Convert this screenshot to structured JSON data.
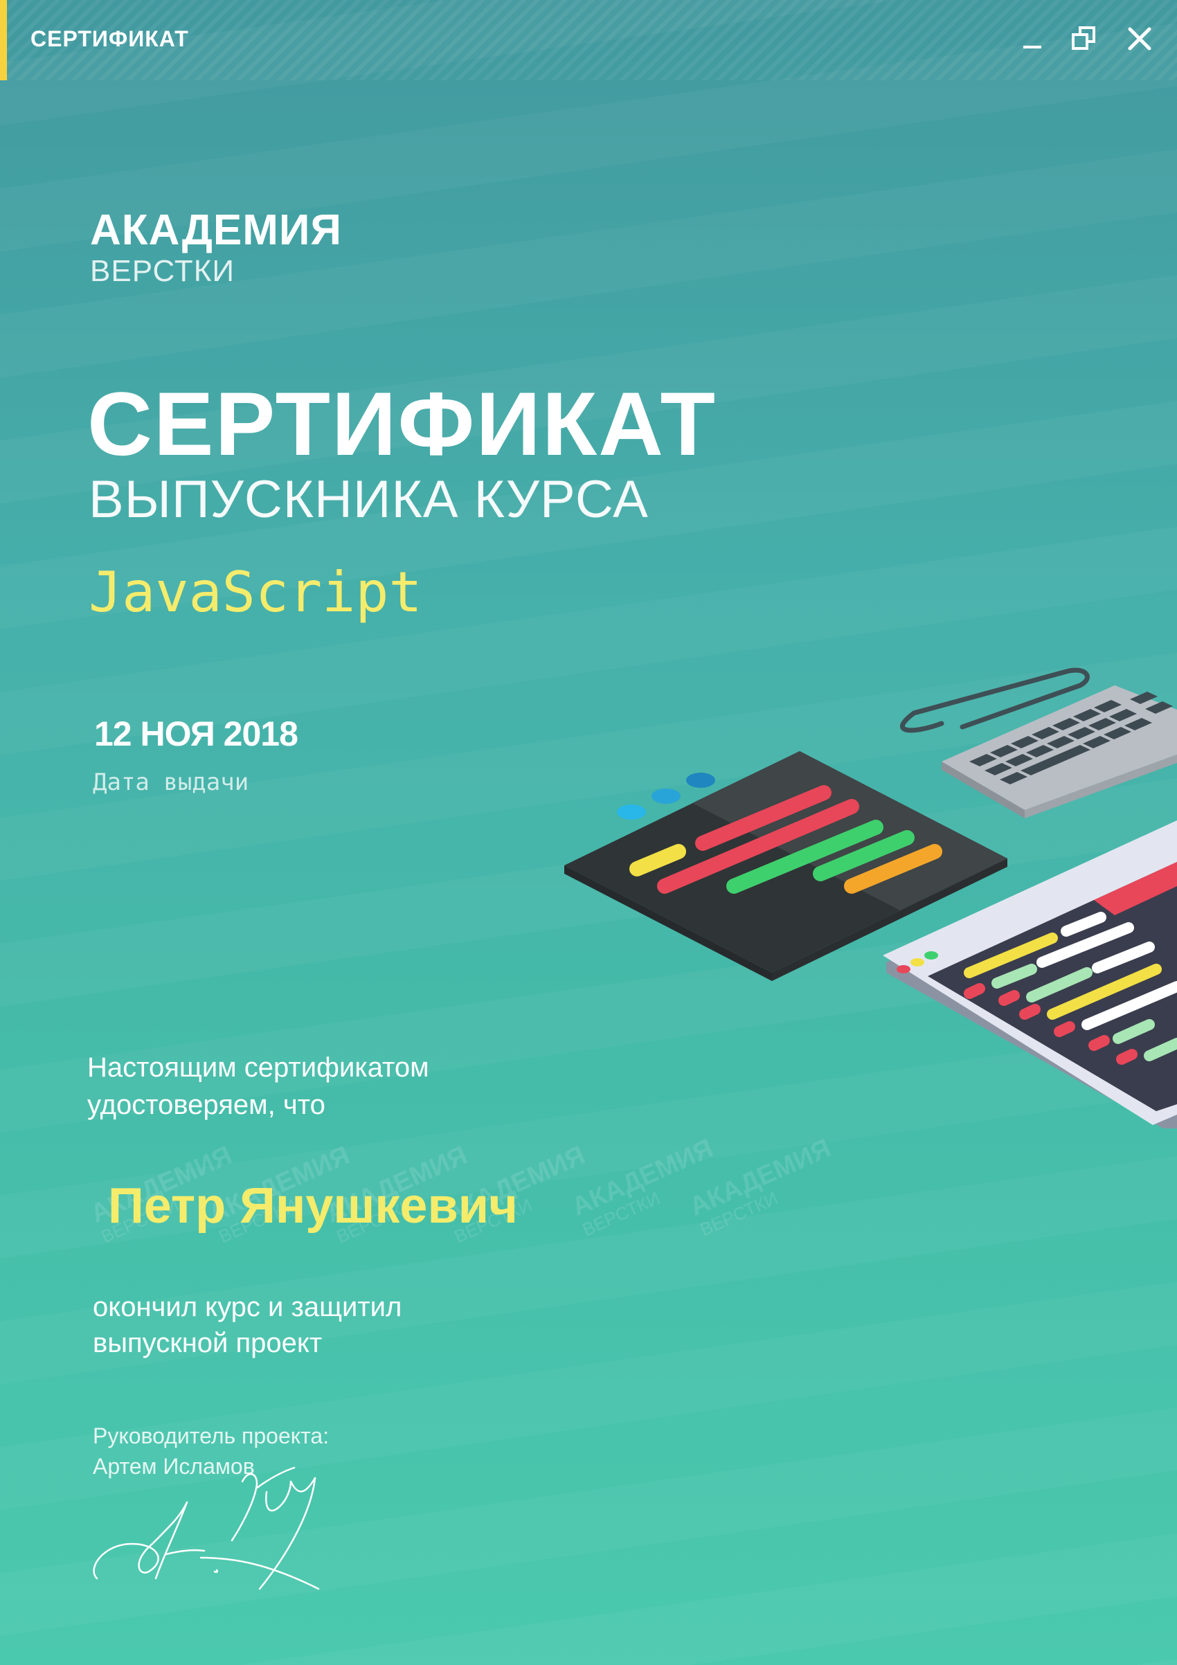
{
  "window": {
    "title": "СЕРТИФИКАТ",
    "accent_color": "#f6d23f",
    "buttons": [
      "minimize-icon",
      "restore-icon",
      "close-icon"
    ]
  },
  "brand": {
    "line1": "АКАДЕМИЯ",
    "line2": "ВЕРСТКИ"
  },
  "certificate": {
    "title": "СЕРТИФИКАТ",
    "subtitle": "ВЫПУСКНИКА КУРСА",
    "course": "JavaScript",
    "course_color": "#f5ec6c",
    "date": "12 НОЯ 2018",
    "date_label": "Дата выдачи",
    "intro_line1": "Настоящим сертификатом",
    "intro_line2": "удостоверяем, что",
    "recipient": "Петр Янушкевич",
    "finish_line1": "окончил курс и защитил",
    "finish_line2": "выпускной проект",
    "lead_role": "Руководитель проекта:",
    "lead_name": "Артем Исламов"
  },
  "watermark": {
    "line1": "АКАДЕМИЯ",
    "line2": "ВЕРСТКИ"
  },
  "colors": {
    "background_top": "#42999f",
    "background_bottom": "#4bc9ae",
    "text": "#ffffff"
  }
}
